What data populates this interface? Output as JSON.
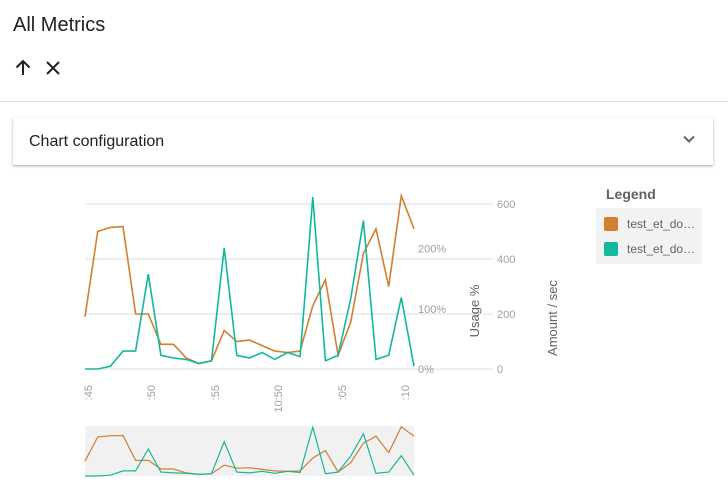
{
  "page": {
    "title": "All Metrics"
  },
  "toolbar": {
    "up_icon": "arrow-up-icon",
    "close_icon": "close-icon"
  },
  "config_panel": {
    "label": "Chart configuration",
    "chevron_icon": "chevron-down-icon"
  },
  "legend": {
    "title": "Legend",
    "items": [
      {
        "label": "test_et_do…",
        "color": "#d27f31"
      },
      {
        "label": "test_et_do…",
        "color": "#12b89b"
      }
    ]
  },
  "colors": {
    "series1": "#d27f31",
    "series2": "#12b89b",
    "grid": "#dadce0",
    "axis_text": "#9aa0a6",
    "navigator_bg": "#f1f1f1"
  },
  "chart_data": {
    "type": "line",
    "xlabel": "",
    "x_tick_labels": [
      ":45",
      ":50",
      ":55",
      "10:50",
      ":05",
      ":10"
    ],
    "y_axes": [
      {
        "label": "Usage %",
        "ticks": [
          "0%",
          "100%",
          "200%"
        ],
        "range": [
          0,
          270
        ]
      },
      {
        "label": "Amount / sec",
        "ticks": [
          "0",
          "200",
          "400",
          "600"
        ],
        "range": [
          0,
          600
        ]
      }
    ],
    "grid": true,
    "legend_position": "right",
    "series": [
      {
        "name": "test_et_do…",
        "axis": "Amount / sec",
        "values": [
          190,
          500,
          515,
          518,
          200,
          200,
          90,
          90,
          40,
          20,
          30,
          140,
          100,
          105,
          85,
          65,
          60,
          65,
          230,
          325,
          50,
          170,
          420,
          510,
          300,
          630,
          510
        ]
      },
      {
        "name": "test_et_do…",
        "axis": "Amount / sec",
        "values": [
          0,
          0,
          10,
          65,
          65,
          345,
          50,
          40,
          35,
          20,
          30,
          440,
          50,
          40,
          60,
          35,
          60,
          45,
          625,
          30,
          50,
          255,
          540,
          35,
          50,
          260,
          10
        ]
      }
    ]
  }
}
